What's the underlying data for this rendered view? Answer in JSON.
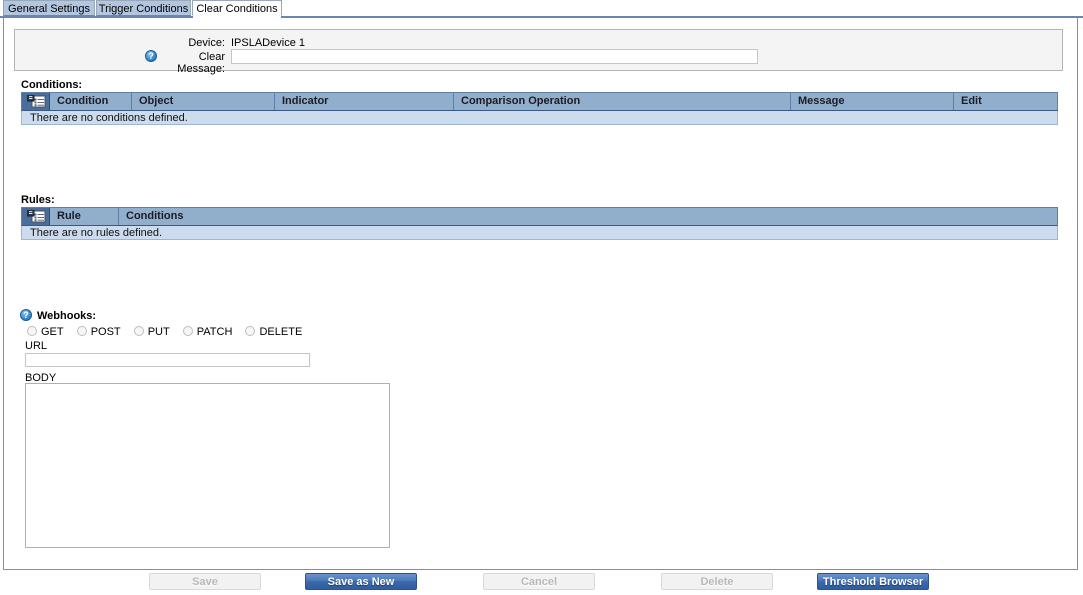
{
  "tabs": [
    {
      "label": "General Settings",
      "active": false
    },
    {
      "label": "Trigger Conditions",
      "active": false
    },
    {
      "label": "Clear Conditions",
      "active": true
    }
  ],
  "device_panel": {
    "device_label": "Device:",
    "device_value": "IPSLADevice 1",
    "clear_message_label": "Clear Message:",
    "clear_message_value": "",
    "clear_message_placeholder": "",
    "help_glyph": "?"
  },
  "conditions": {
    "section_label": "Conditions:",
    "columns": [
      "Condition",
      "Object",
      "Indicator",
      "Comparison Operation",
      "Message",
      "Edit"
    ],
    "empty_text": "There are no conditions defined.",
    "add_icon": "list-add-icon"
  },
  "rules": {
    "section_label": "Rules:",
    "columns": [
      "Rule",
      "Conditions"
    ],
    "empty_text": "There are no rules defined.",
    "add_icon": "list-add-icon"
  },
  "webhooks": {
    "section_label": "Webhooks:",
    "help_glyph": "?",
    "methods": [
      {
        "label": "GET",
        "selected": false
      },
      {
        "label": "POST",
        "selected": false
      },
      {
        "label": "PUT",
        "selected": false
      },
      {
        "label": "PATCH",
        "selected": false
      },
      {
        "label": "DELETE",
        "selected": false
      }
    ],
    "url_label": "URL",
    "url_value": "",
    "body_label": "BODY",
    "body_value": ""
  },
  "footer": {
    "save": "Save",
    "save_as_new": "Save as New",
    "cancel": "Cancel",
    "delete": "Delete",
    "threshold_browser": "Threshold Browser"
  },
  "colors": {
    "tab_inactive": "#b3c6e0",
    "tab_active": "#ffffff",
    "grid_header": "#92aecd",
    "grid_empty_row": "#ccdcee",
    "grid_icon_cell": "#4a6d9c",
    "primary_button": "#3a69ac",
    "panel_bg": "#f4f4f4"
  }
}
